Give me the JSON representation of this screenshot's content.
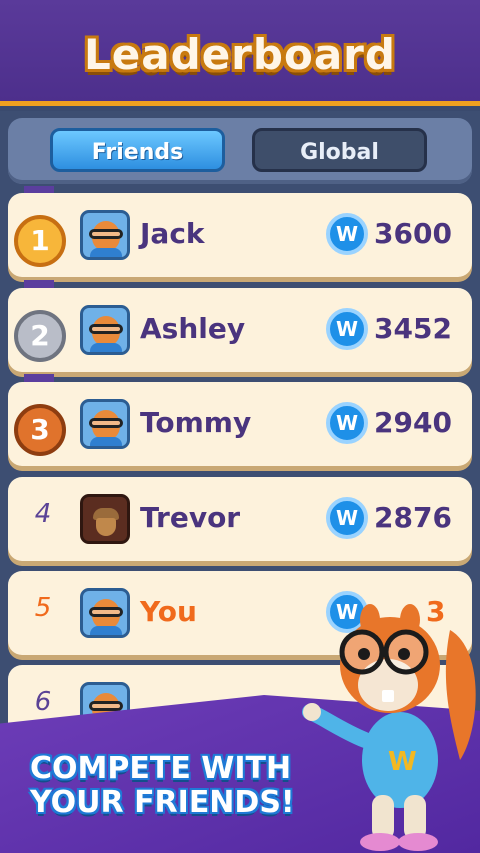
{
  "header": {
    "title": "Leaderboard"
  },
  "tabs": [
    {
      "label": "Friends",
      "selected": true
    },
    {
      "label": "Global",
      "selected": false
    }
  ],
  "coin_symbol": "W",
  "rows": [
    {
      "rank": "1",
      "name": "Jack",
      "score": "3600",
      "medal": "gold"
    },
    {
      "rank": "2",
      "name": "Ashley",
      "score": "3452",
      "medal": "silver"
    },
    {
      "rank": "3",
      "name": "Tommy",
      "score": "2940",
      "medal": "bronze"
    },
    {
      "rank": "4",
      "name": "Trevor",
      "score": "2876",
      "avatar": "acorn-icon"
    },
    {
      "rank": "5",
      "name": "You",
      "score": "3",
      "highlight": true
    },
    {
      "rank": "6"
    }
  ],
  "promo": {
    "line1": "COMPETE WITH",
    "line2": "YOUR FRIENDS!"
  },
  "colors": {
    "accent_orange": "#f06a1c",
    "name_purple": "#4a347e",
    "tab_active_blue": "#2e8fe0",
    "row_background": "#fdf2dc",
    "header_purple": "#4d2f8c"
  }
}
